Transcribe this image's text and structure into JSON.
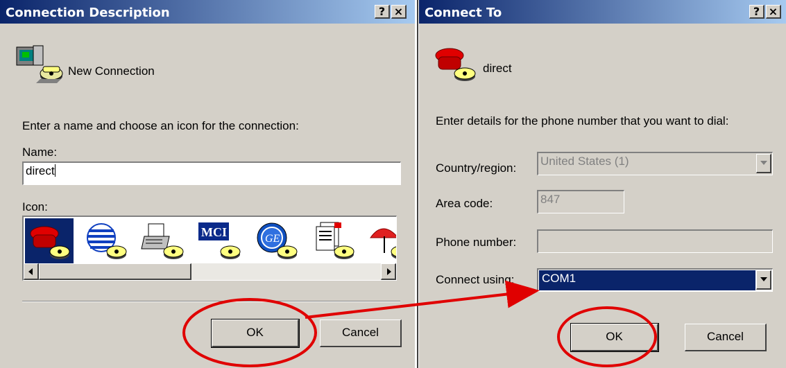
{
  "dialog1": {
    "title": "Connection Description",
    "help_label": "?",
    "close_label": "×",
    "connection_name": "New Connection",
    "prompt": "Enter a name and choose an icon for the connection:",
    "name_label": "Name:",
    "name_value": "direct",
    "icon_label": "Icon:",
    "icons": [
      "red-phone-icon",
      "globe-phone-icon",
      "fax-phone-icon",
      "mci-phone-icon",
      "ge-phone-icon",
      "document-phone-icon",
      "umbrella-phone-icon"
    ],
    "ok_label": "OK",
    "cancel_label": "Cancel"
  },
  "dialog2": {
    "title": "Connect To",
    "help_label": "?",
    "close_label": "×",
    "connection_name": "direct",
    "prompt": "Enter details for the phone number that you want to dial:",
    "country_label": "Country/region:",
    "country_value": "United States (1)",
    "area_label": "Area code:",
    "area_value": "847",
    "phone_label": "Phone number:",
    "phone_value": "",
    "connect_label": "Connect using:",
    "connect_value": "COM1",
    "ok_label": "OK",
    "cancel_label": "Cancel"
  },
  "colors": {
    "title_gradient_start": "#0a246a",
    "title_gradient_end": "#a6caf0",
    "dialog_bg": "#d4d0c8",
    "selection": "#0a246a",
    "annotation": "#e00000"
  }
}
